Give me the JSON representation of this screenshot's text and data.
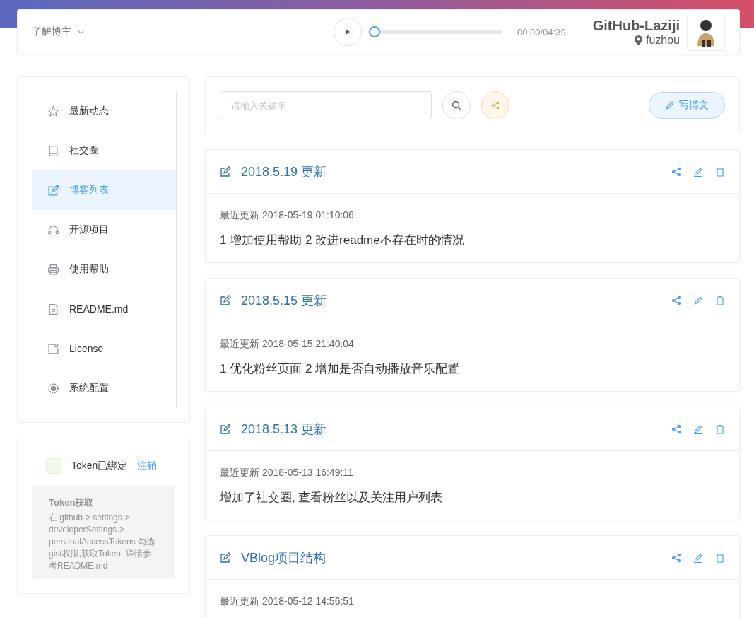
{
  "header": {
    "menu_label": "了解博主",
    "player": {
      "level": 0,
      "time": "00:00/04:39"
    },
    "user": {
      "name": "GitHub-Laziji",
      "location": "fuzhou"
    }
  },
  "sidebar": {
    "items": [
      {
        "label": "最新动态",
        "selected": false
      },
      {
        "label": "社交圈",
        "selected": false
      },
      {
        "label": "博客列表",
        "selected": true
      },
      {
        "label": "开源项目",
        "selected": false
      },
      {
        "label": "使用帮助",
        "selected": false
      },
      {
        "label": "README.md",
        "selected": false
      },
      {
        "label": "License",
        "selected": false
      },
      {
        "label": "系统配置",
        "selected": false
      }
    ]
  },
  "token": {
    "status": "Token已绑定",
    "action": "注销",
    "help_title": "Token获取",
    "help_text": "在 github-> settings-> developerSettings-> personalAccessTokens 勾选gist权限,获取Token. 详情参考README.md"
  },
  "toolbar": {
    "search_placeholder": "请输入关键字",
    "write_button": "写博文"
  },
  "posts": [
    {
      "title": "2018.5.19 更新",
      "updated": "最近更新 2018-05-19 01:10:06",
      "summary": "1 增加使用帮助 2 改进readme不存在时的情况"
    },
    {
      "title": "2018.5.15 更新",
      "updated": "最近更新 2018-05-15 21:40:04",
      "summary": "1 优化粉丝页面 2 增加是否自动播放音乐配置"
    },
    {
      "title": "2018.5.13 更新",
      "updated": "最近更新 2018-05-13 16:49:11",
      "summary": "增加了社交圈, 查看粉丝以及关注用户列表"
    },
    {
      "title": "VBlog项目结构",
      "updated": "最近更新 2018-05-12 14:56:51"
    }
  ]
}
